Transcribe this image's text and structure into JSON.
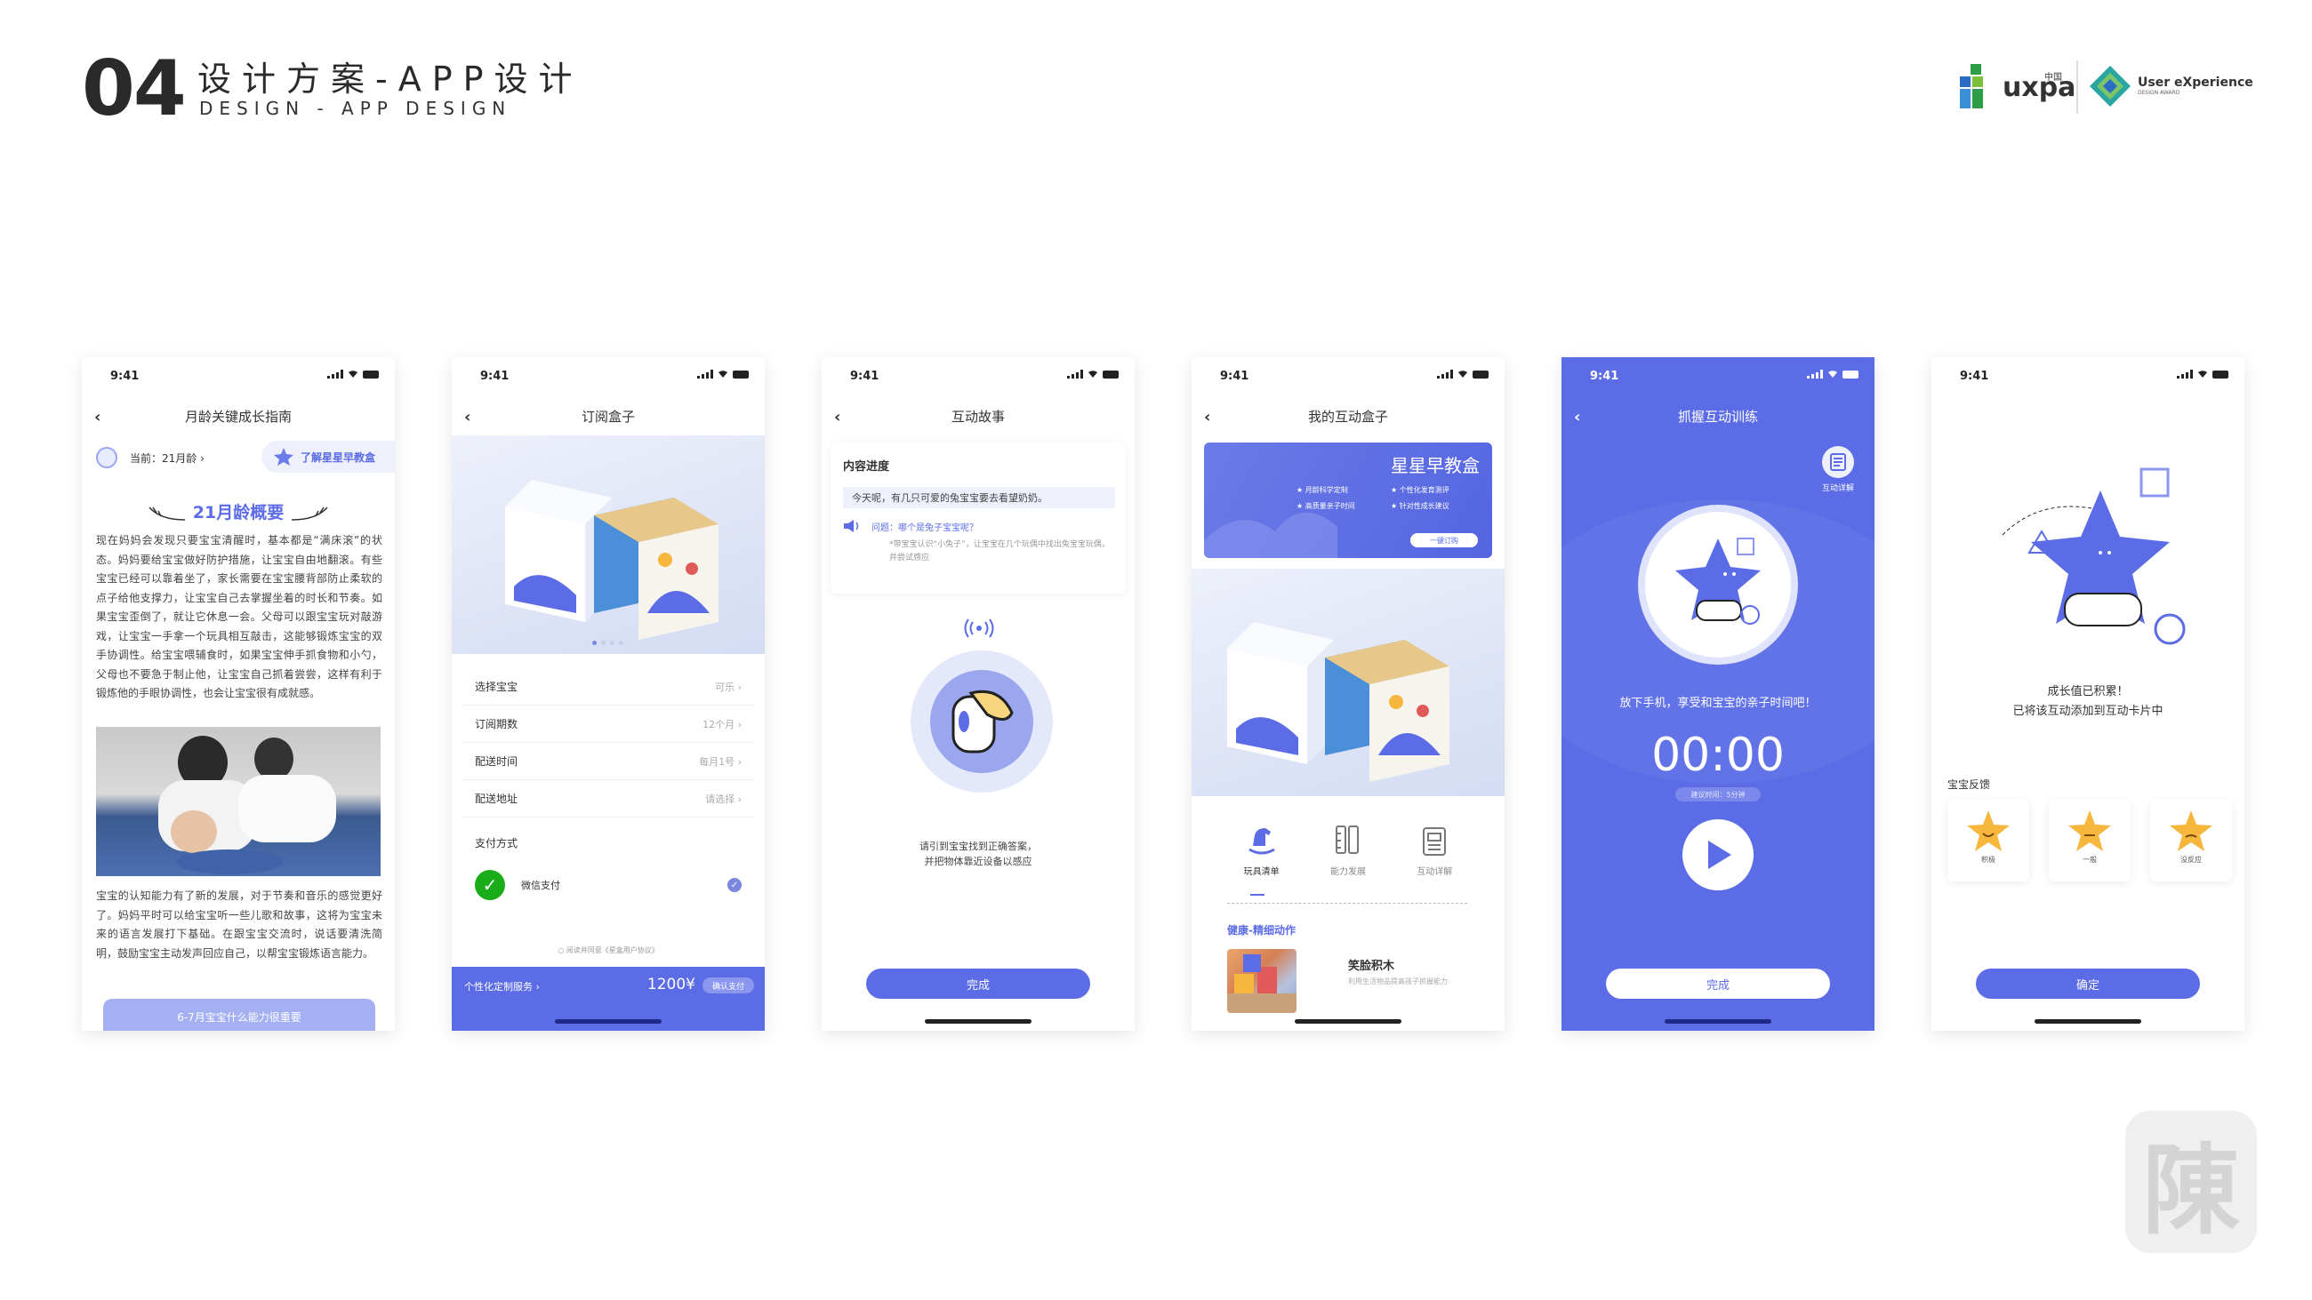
{
  "header": {
    "number": "04",
    "title": "设计方案-APP设计",
    "subtitle": "DESIGN - APP DESIGN",
    "logo_uxpa": "uxpa",
    "logo_uxpa_cn": "中国",
    "logo_ux_title": "User eXperience",
    "logo_ux_sub": "DESIGN AWARD"
  },
  "status_time": "9:41",
  "screen1": {
    "nav_title": "月龄关键成长指南",
    "current_label": "当前：21月龄 ›",
    "tag": "了解星星早教盒",
    "heading": "21月龄概要",
    "para1": "现在妈妈会发现只要宝宝清醒时，基本都是“满床滚”的状态。妈妈要给宝宝做好防护措施，让宝宝自由地翻滚。有些宝宝已经可以靠着坐了，家长需要在宝宝腰背部防止柔软的点子给他支撑力，让宝宝自己去掌握坐着的时长和节奏。如果宝宝歪倒了，就让它休息一会。父母可以跟宝宝玩对敲游戏，让宝宝一手拿一个玩具相互敲击，这能够锻炼宝宝的双手协调性。给宝宝喂辅食时，如果宝宝伸手抓食物和小勺，父母也不要急于制止他，让宝宝自己抓着尝尝，这样有利于锻炼他的手眼协调性，也会让宝宝很有成就感。",
    "para2": "宝宝的认知能力有了新的发展，对于节奏和音乐的感觉更好了。妈妈平时可以给宝宝听一些儿歌和故事，这将为宝宝未来的语言发展打下基础。在跟宝宝交流时，说话要清洗简明，鼓励宝宝主动发声回应自己，以帮宝宝锻炼语言能力。",
    "bottom_button": "6-7月宝宝什么能力很重要"
  },
  "screen2": {
    "nav_title": "订阅盒子",
    "rows": [
      {
        "label": "选择宝宝",
        "value": "可乐 ›"
      },
      {
        "label": "订阅期数",
        "value": "12个月 ›"
      },
      {
        "label": "配送时间",
        "value": "每月1号 ›"
      },
      {
        "label": "配送地址",
        "value": "请选择 ›"
      }
    ],
    "pay_title": "支付方式",
    "wechat_pay": "微信支付",
    "agree": "阅读并同意《星盒用户协议》",
    "footer_left": "个性化定制服务 ›",
    "price": "1200¥",
    "pay_button": "确认支付"
  },
  "screen3": {
    "nav_title": "互动故事",
    "card_title": "内容进度",
    "story": "今天呢，有几只可爱的兔宝宝要去看望奶奶。",
    "question": "问题：哪个是兔子宝宝呢？",
    "hint": "*带宝宝认识“小兔子”，让宝宝在几个玩偶中找出兔宝宝玩偶，并尝试感应",
    "guide_line1": "请引到宝宝找到正确答案，",
    "guide_line2": "并把物体靠近设备以感应",
    "done": "完成"
  },
  "screen4": {
    "nav_title": "我的互动盒子",
    "banner_title": "星星早教盒",
    "features": [
      "月龄科学定制",
      "个性化发育测评",
      "高质量亲子时间",
      "针对性成长建议"
    ],
    "order_button": "一键订购",
    "tabs": [
      "玩具清单",
      "能力发展",
      "互动详解"
    ],
    "category": "健康-精细动作",
    "item_title": "笑脸积木",
    "item_desc": "利用生活物品提高孩子抓握能力"
  },
  "screen5": {
    "nav_title": "抓握互动训练",
    "detail_label": "互动详解",
    "tip": "放下手机，享受和宝宝的亲子时间吧！",
    "timer": "00:00",
    "recommend": "建议时间：5分钟",
    "done": "完成"
  },
  "screen6": {
    "msg_line1": "成长值已积累！",
    "msg_line2": "已将该互动添加到互动卡片中",
    "feedback_title": "宝宝反馈",
    "feedback": [
      "积极",
      "一般",
      "没反应"
    ],
    "confirm": "确定"
  },
  "seal_char": "陳",
  "colors": {
    "primary": "#5b6ce6",
    "primary_light": "#eef0fc",
    "wechat": "#1aad19",
    "star": "#f6b73c"
  }
}
